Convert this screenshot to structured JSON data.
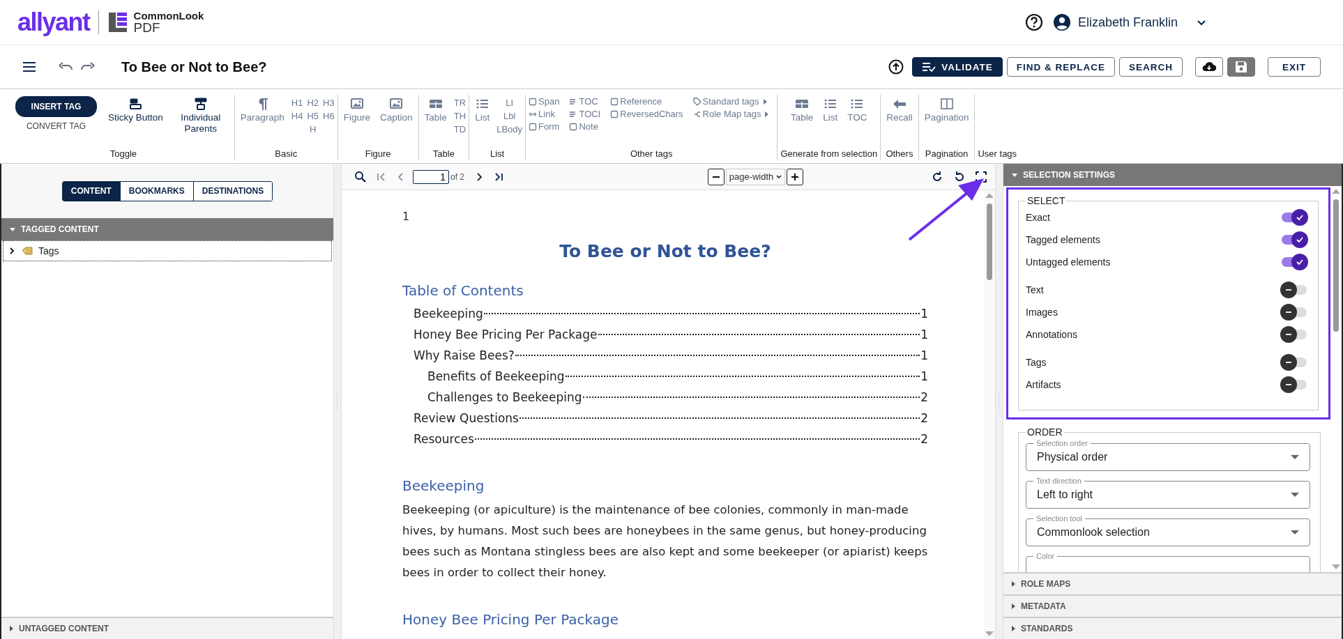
{
  "header": {
    "brand": "allyant",
    "product_name": "CommonLook",
    "product_sub": "PDF",
    "user": "Elizabeth Franklin"
  },
  "titlebar": {
    "title": "To Bee or Not to Bee?",
    "validate": "VALIDATE",
    "find_replace": "FIND & REPLACE",
    "search": "SEARCH",
    "exit": "EXIT"
  },
  "toolbar": [
    {
      "label": "Toggle",
      "items": [
        {
          "kind": "insert",
          "label": "INSERT TAG",
          "secondary": "CONVERT TAG"
        },
        {
          "kind": "big",
          "label": "Sticky Button",
          "disabled": false
        },
        {
          "kind": "big",
          "label": "Individual Parents",
          "disabled": false
        }
      ]
    },
    {
      "label": "Basic",
      "items": [
        {
          "kind": "big",
          "label": "Paragraph",
          "disabled": true
        },
        {
          "kind": "grid",
          "labels": [
            "H1",
            "H2",
            "H3",
            "H4",
            "H5",
            "H6",
            "H"
          ]
        }
      ]
    },
    {
      "label": "Figure",
      "items": [
        {
          "kind": "big",
          "label": "Figure",
          "disabled": true
        },
        {
          "kind": "big",
          "label": "Caption",
          "disabled": true
        }
      ]
    },
    {
      "label": "Table",
      "items": [
        {
          "kind": "big",
          "label": "Table",
          "disabled": true
        },
        {
          "kind": "column",
          "labels": [
            "TR",
            "TH",
            "TD"
          ]
        }
      ]
    },
    {
      "label": "List",
      "items": [
        {
          "kind": "big",
          "label": "List",
          "disabled": true
        },
        {
          "kind": "column",
          "labels": [
            "LI",
            "Lbl",
            "LBody"
          ]
        }
      ]
    },
    {
      "label": "Other tags",
      "items": [
        {
          "kind": "links",
          "links": [
            {
              "label": "Span",
              "submenu": false
            },
            {
              "label": "Link",
              "submenu": false
            },
            {
              "label": "Form",
              "submenu": false
            }
          ]
        },
        {
          "kind": "links",
          "links": [
            {
              "label": "TOC",
              "submenu": false
            },
            {
              "label": "TOCI",
              "submenu": false
            },
            {
              "label": "Note",
              "submenu": false
            }
          ]
        },
        {
          "kind": "links",
          "links": [
            {
              "label": "Reference",
              "submenu": false
            },
            {
              "label": "ReversedChars",
              "submenu": false
            }
          ]
        },
        {
          "kind": "links",
          "links": [
            {
              "label": "Standard tags",
              "submenu": true
            },
            {
              "label": "Role Map tags",
              "submenu": true
            }
          ]
        }
      ]
    },
    {
      "label": "Generate from selection",
      "items": [
        {
          "kind": "big",
          "label": "Table",
          "disabled": true
        },
        {
          "kind": "big",
          "label": "List",
          "disabled": true
        },
        {
          "kind": "big",
          "label": "TOC",
          "disabled": true
        }
      ]
    },
    {
      "label": "Others",
      "items": [
        {
          "kind": "big",
          "label": "Recall",
          "disabled": true
        }
      ]
    },
    {
      "label": "Pagination",
      "items": [
        {
          "kind": "big",
          "label": "Pagination",
          "disabled": true
        }
      ]
    },
    {
      "label": "User tags"
    }
  ],
  "left_panel": {
    "tabs": [
      {
        "label": "CONTENT",
        "selected": true
      },
      {
        "label": "BOOKMARKS",
        "selected": false
      },
      {
        "label": "DESTINATIONS",
        "selected": false
      }
    ],
    "tagged": {
      "title": "TAGGED CONTENT",
      "expanded": true,
      "tree": [
        {
          "label": "Tags",
          "expanded": false
        }
      ]
    },
    "untagged": {
      "title": "UNTAGGED CONTENT",
      "expanded": false
    }
  },
  "viewer": {
    "page": "1",
    "page_count": "of 2",
    "zoom": "page-width",
    "document": {
      "page_number": "1",
      "title": "To Bee or Not to Bee?",
      "toc_heading": "Table of Contents",
      "toc": [
        {
          "label": "Beekeeping",
          "page": "1"
        },
        {
          "label": "Honey Bee Pricing Per Package",
          "page": "1"
        },
        {
          "label": "Why Raise Bees?",
          "page": "1",
          "children": [
            {
              "label": "Benefits of Beekeeping",
              "page": "1"
            },
            {
              "label": "Challenges to Beekeeping",
              "page": "2"
            }
          ]
        },
        {
          "label": "Review Questions",
          "page": "2"
        },
        {
          "label": "Resources",
          "page": "2"
        }
      ],
      "sections": [
        {
          "heading": "Beekeeping",
          "text": "Beekeeping (or apiculture) is the maintenance of bee colonies, commonly in man-made hives, by humans. Most such bees are honeybees in the same genus, but honey-producing bees such as Montana stingless bees are also kept and some beekeeper (or apiarist) keeps bees in order to collect their honey."
        },
        {
          "heading": "Honey Bee Pricing Per Package"
        }
      ]
    }
  },
  "right_panel": {
    "selection_settings": {
      "title": "SELECTION SETTINGS",
      "expanded": true,
      "select": {
        "legend": "SELECT",
        "groups": [
          [
            {
              "label": "Exact",
              "on": true
            },
            {
              "label": "Tagged elements",
              "on": true
            },
            {
              "label": "Untagged elements",
              "on": true
            }
          ],
          [
            {
              "label": "Text",
              "on": false
            },
            {
              "label": "Images",
              "on": false
            },
            {
              "label": "Annotations",
              "on": false
            }
          ],
          [
            {
              "label": "Tags",
              "on": false
            },
            {
              "label": "Artifacts",
              "on": false
            }
          ]
        ]
      },
      "order": {
        "legend": "ORDER",
        "fields": [
          {
            "label": "Selection order",
            "value": "Physical order"
          },
          {
            "label": "Text direction",
            "value": "Left to right"
          },
          {
            "label": "Selection tool",
            "value": "Commonlook selection"
          },
          {
            "label": "Color"
          }
        ]
      }
    },
    "panels": [
      {
        "title": "ROLE MAPS",
        "expanded": false
      },
      {
        "title": "METADATA",
        "expanded": false
      },
      {
        "title": "STANDARDS",
        "expanded": false
      }
    ]
  }
}
